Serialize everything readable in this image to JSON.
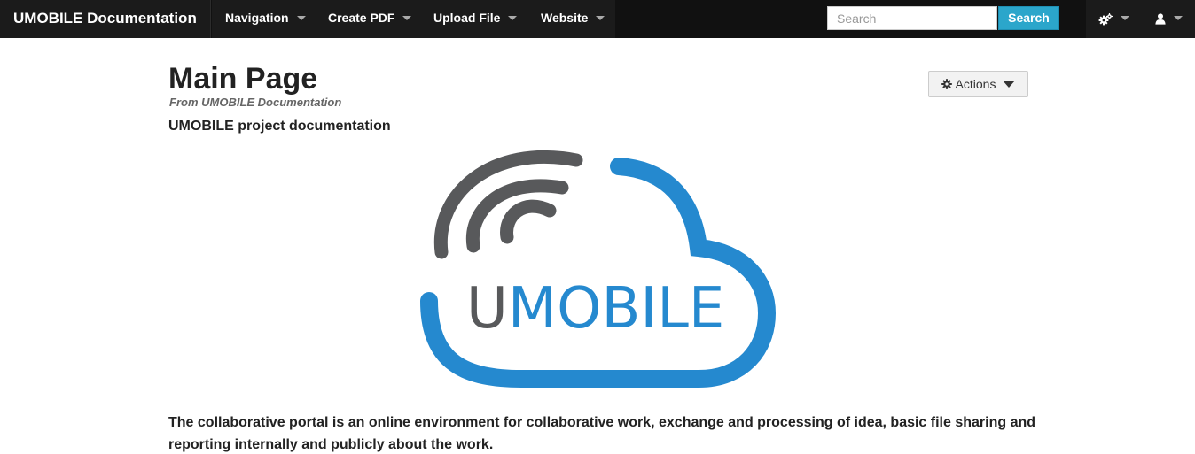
{
  "navbar": {
    "brand": "UMOBILE Documentation",
    "items": [
      {
        "label": "Navigation"
      },
      {
        "label": "Create PDF"
      },
      {
        "label": "Upload File"
      },
      {
        "label": "Website"
      }
    ],
    "search": {
      "placeholder": "Search",
      "value": "",
      "button_label": "Search"
    },
    "right_icons": [
      "cogs-icon",
      "user-icon"
    ]
  },
  "page": {
    "title": "Main Page",
    "subtitle": "From UMOBILE Documentation",
    "actions_label": "Actions",
    "section_heading": "UMOBILE project documentation",
    "logo": {
      "text_prefix": "U",
      "text_rest": "MOBILE"
    },
    "body": "The collaborative portal is an online environment for collaborative work, exchange and processing of idea, basic file sharing and reporting internally and publicly about the work."
  },
  "colors": {
    "navbar_bg": "#111111",
    "search_button": "#2ba6cb",
    "logo_blue": "#2589cf",
    "logo_gray": "#58595b"
  }
}
